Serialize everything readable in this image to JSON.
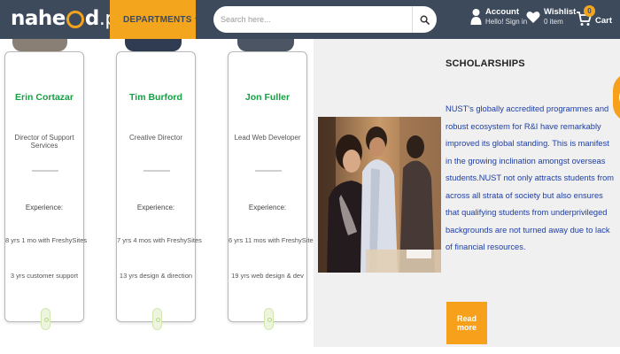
{
  "header": {
    "logo": {
      "left": "nahe",
      "middle": "d",
      "suffix": ".pk"
    },
    "departments_label": "DEPARTMENTS",
    "search_placeholder": "Search here...",
    "account": {
      "title": "Account",
      "subtitle": "Hello! Sign in"
    },
    "wishlist": {
      "title": "Wishlist",
      "subtitle": "0 item"
    },
    "cart": {
      "label": "Cart",
      "count": "0"
    }
  },
  "team": [
    {
      "name": "Erin Cortazar",
      "role": "Director of Support Services",
      "experience_label": "Experience:",
      "line1": "8 yrs 1 mo with FreshySites",
      "line2": "3 yrs customer support"
    },
    {
      "name": "Tim Burford",
      "role": "Creative Director",
      "experience_label": "Experience:",
      "line1": "7 yrs 4 mos with FreshySites",
      "line2": "13 yrs design & direction"
    },
    {
      "name": "Jon Fuller",
      "role": "Lead Web Developer",
      "experience_label": "Experience:",
      "line1": "6 yrs 11 mos with FreshySites",
      "line2": "19 yrs web design & dev"
    }
  ],
  "scholarship": {
    "title": "SCHOLARSHIPS",
    "body": "NUST's globally accredited programmes and robust ecosystem for R&I have remarkably improved its global standing. This is manifest in the growing inclination amongst overseas students.NUST not only attracts students from across all strata of society but also ensures that qualifying students from underprivileged backgrounds are not turned away due to lack of financial resources.",
    "button_label": "Read more"
  },
  "colors": {
    "header_bg": "#3d4a5c",
    "accent": "#f2a51d",
    "name_green": "#15a142",
    "body_blue": "#1d3ea6"
  }
}
